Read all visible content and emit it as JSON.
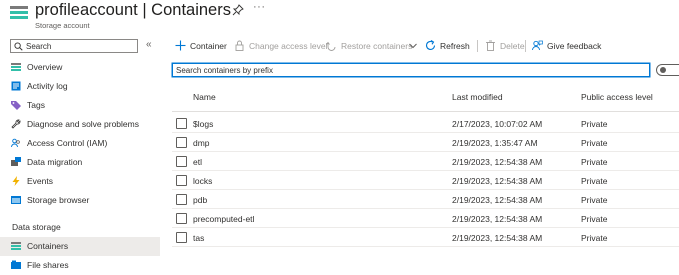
{
  "header": {
    "title": "profileaccount | Containers",
    "subtitle": "Storage account",
    "more": "···"
  },
  "sidebar": {
    "search_placeholder": "Search",
    "collapse": "«",
    "items": [
      {
        "label": "Overview",
        "icon": "overview-icon"
      },
      {
        "label": "Activity log",
        "icon": "activity-log-icon"
      },
      {
        "label": "Tags",
        "icon": "tag-icon"
      },
      {
        "label": "Diagnose and solve problems",
        "icon": "wrench-icon"
      },
      {
        "label": "Access Control (IAM)",
        "icon": "people-icon"
      },
      {
        "label": "Data migration",
        "icon": "migration-icon"
      },
      {
        "label": "Events",
        "icon": "lightning-icon"
      },
      {
        "label": "Storage browser",
        "icon": "storage-browser-icon"
      }
    ],
    "section_data_storage": "Data storage",
    "data_storage_items": [
      {
        "label": "Containers",
        "icon": "containers-icon",
        "active": true
      },
      {
        "label": "File shares",
        "icon": "file-shares-icon"
      }
    ]
  },
  "toolbar": {
    "container": "Container",
    "change_access": "Change access level",
    "restore": "Restore containers",
    "refresh": "Refresh",
    "delete": "Delete",
    "feedback": "Give feedback"
  },
  "filter": {
    "placeholder": "Search containers by prefix"
  },
  "table": {
    "columns": [
      "Name",
      "Last modified",
      "Public access level"
    ],
    "rows": [
      {
        "name": "$logs",
        "modified": "2/17/2023, 10:07:02 AM",
        "access": "Private"
      },
      {
        "name": "dmp",
        "modified": "2/19/2023, 1:35:47 AM",
        "access": "Private"
      },
      {
        "name": "etl",
        "modified": "2/19/2023, 12:54:38 AM",
        "access": "Private"
      },
      {
        "name": "locks",
        "modified": "2/19/2023, 12:54:38 AM",
        "access": "Private"
      },
      {
        "name": "pdb",
        "modified": "2/19/2023, 12:54:38 AM",
        "access": "Private"
      },
      {
        "name": "precomputed-etl",
        "modified": "2/19/2023, 12:54:38 AM",
        "access": "Private"
      },
      {
        "name": "tas",
        "modified": "2/19/2023, 12:54:38 AM",
        "access": "Private"
      }
    ]
  },
  "colors": {
    "accent": "#0078d4",
    "storage_teal": "#32bfa9",
    "storage_gray": "#a0a0a0",
    "active_bg": "#edebe9"
  }
}
